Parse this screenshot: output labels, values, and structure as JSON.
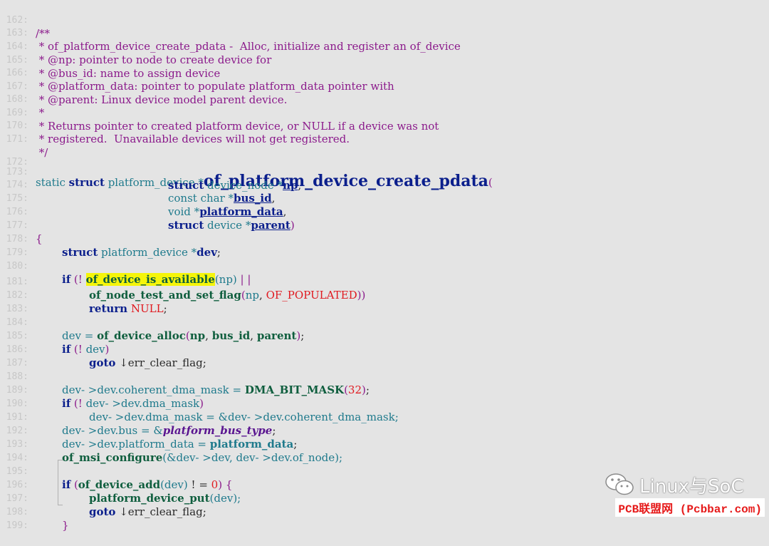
{
  "code": {
    "line_numbers": [
      "162:",
      "163:",
      "164:",
      "165:",
      "166:",
      "167:",
      "168:",
      "169:",
      "170:",
      "171:",
      "172:",
      "173:",
      "174:",
      "175:",
      "176:",
      "177:",
      "178:",
      "179:",
      "180:",
      "181:",
      "182:",
      "183:",
      "184:",
      "185:",
      "186:",
      "187:",
      "188:",
      "189:",
      "190:",
      "191:",
      "192:",
      "193:",
      "194:",
      "195:",
      "196:",
      "197:",
      "198:",
      "199:"
    ],
    "l162": "/**",
    "l163": " * of_platform_device_create_pdata -  Alloc, initialize and register an of_device",
    "l164": " * @np: pointer to node to create device for",
    "l165": " * @bus_id: name to assign device",
    "l166": " * @platform_data: pointer to populate platform_data pointer with",
    "l167": " * @parent: Linux device model parent device.",
    "l168": " *",
    "l169": " * Returns pointer to created platform device, or NULL if a device was not",
    "l170": " * registered.  Unavailable devices will not get registered.",
    "l171": " */",
    "t_static": "static ",
    "t_struct": "struct",
    "t_platform_device_ptr": " platform_device *",
    "t_fn_name": "of_platform_device_create_pdata",
    "t_lparen": "(",
    "t_rparen": ")",
    "t_device_node": " device_node *",
    "t_np": "np",
    "t_comma": ",",
    "t_const_char": "const char *",
    "t_bus_id": "bus_id",
    "t_void": "void *",
    "t_platform_data": "platform_data",
    "t_device_ptr": " device *",
    "t_parent": "parent",
    "t_lbrace": "{",
    "t_rbrace": "}",
    "t_platform_device_star": " platform_device *",
    "t_dev": "dev",
    "t_semicolon": ";",
    "t_if": "if",
    "t_not_paren": " (! ",
    "t_of_device_is_available": "of_device_is_available",
    "t_np_paren": "(np)",
    "t_oror": " | |",
    "t_of_node_test": "of_node_test_and_set_flag",
    "t_of_populated": "OF_POPULATED",
    "t_return": "return",
    "t_null": "NULL",
    "t_dev_assign": "dev = ",
    "t_of_device_alloc": "of_device_alloc",
    "t_bus_id_b": "bus_id",
    "t_parent_b": "parent",
    "t_goto": "goto",
    "t_err_clear_flag": " ↓err_clear_flag;",
    "t_coherent": "dev- >dev.coherent_dma_mask = ",
    "t_dma_bit_mask": "DMA_BIT_MASK",
    "t_32": "32",
    "t_dev_dma": "dev- >dev.dma_mask",
    "t_l190": "dev- >dev.dma_mask = &dev- >dev.coherent_dma_mask;",
    "t_bus_assign": "dev- >dev.bus = &",
    "t_platform_bus_type": "platform_bus_type",
    "t_pdata_assign": "dev- >dev.platform_data = ",
    "t_of_msi_configure": "of_msi_configure",
    "t_msi_args": "(&dev- >dev, dev- >dev.of_node);",
    "t_of_device_add": "of_device_add",
    "t_dev_paren": "(dev)",
    "t_ne0": " ! = ",
    "t_zero": "0",
    "t_close_brace_open": ") {",
    "t_platform_device_put": "platform_device_put",
    "t_dev_paren_semi": "(dev);"
  },
  "watermark": {
    "text": "Linux与SoC",
    "icon": "wechat-icon"
  },
  "footer_mark": "PCB联盟网 (Pcbbar.com)",
  "colors": {
    "background": "#e4e4e4",
    "comment": "#8b1a8b",
    "keyword": "#0b1f8c",
    "type": "#1f7a8c",
    "function": "#0f5e3e",
    "macro": "#e0191f",
    "highlight": "#f5f50a"
  }
}
